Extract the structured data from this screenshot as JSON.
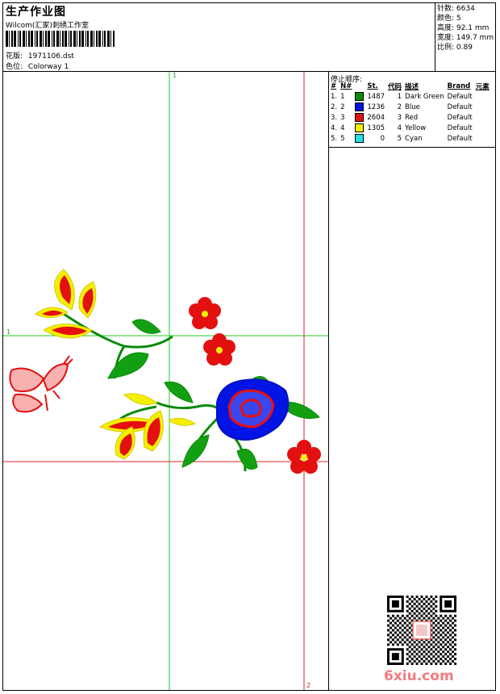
{
  "header": {
    "title": "生产作业图",
    "company": "Wilcom(汇家)刺绣工作室",
    "design_label": "花版:",
    "design_file": "1971106.dst",
    "color_label": "色位:",
    "colorway": "Colorway 1"
  },
  "stats": [
    {
      "label": "针数:",
      "value": "6634"
    },
    {
      "label": "颜色:",
      "value": "5"
    },
    {
      "label": "高度:",
      "value": "92.1 mm"
    },
    {
      "label": "宽度:",
      "value": "149.7 mm"
    },
    {
      "label": "比例:",
      "value": "0.89"
    }
  ],
  "stop_sequence": {
    "title": "停止顺序:",
    "columns": [
      "#",
      "N#",
      "St.",
      "代码",
      "描述",
      "Brand",
      "元素"
    ],
    "rows": [
      {
        "index": "1.",
        "n": "1",
        "color": "#0a8a0a",
        "stitches": "1487",
        "code": "1",
        "desc": "Dark Green",
        "brand": "Default"
      },
      {
        "index": "2.",
        "n": "2",
        "color": "#0014e6",
        "stitches": "1236",
        "code": "2",
        "desc": "Blue",
        "brand": "Default"
      },
      {
        "index": "3.",
        "n": "3",
        "color": "#e41010",
        "stitches": "2604",
        "code": "3",
        "desc": "Red",
        "brand": "Default"
      },
      {
        "index": "4.",
        "n": "4",
        "color": "#f5f000",
        "stitches": "1305",
        "code": "4",
        "desc": "Yellow",
        "brand": "Default"
      },
      {
        "index": "5.",
        "n": "5",
        "color": "#20e0e8",
        "stitches": "0",
        "code": "5",
        "desc": "Cyan",
        "brand": "Default"
      }
    ]
  },
  "guides": {
    "green_top_label": "1",
    "green_left_label": "1",
    "red_bottom_label": "2"
  },
  "watermark": "6xiu.com"
}
